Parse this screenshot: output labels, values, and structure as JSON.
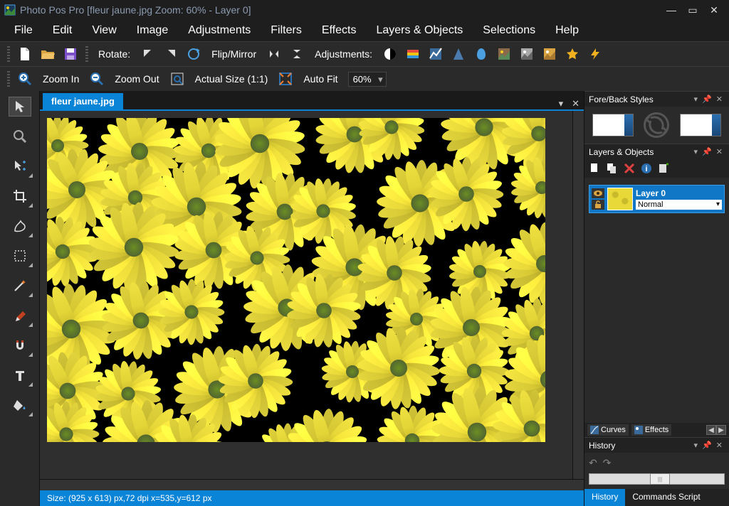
{
  "titlebar": {
    "app_name": "Photo Pos Pro",
    "document": "[fleur jaune.jpg Zoom: 60% - Layer 0]"
  },
  "menu": {
    "items": [
      "File",
      "Edit",
      "View",
      "Image",
      "Adjustments",
      "Filters",
      "Effects",
      "Layers & Objects",
      "Selections",
      "Help"
    ]
  },
  "toolbar1": {
    "rotate_label": "Rotate:",
    "flip_label": "Flip/Mirror",
    "adjustments_label": "Adjustments:"
  },
  "toolbar2": {
    "zoom_in": "Zoom In",
    "zoom_out": "Zoom Out",
    "actual_size": "Actual Size (1:1)",
    "auto_fit": "Auto Fit",
    "zoom_value": "60%"
  },
  "document_tab": {
    "name": "fleur jaune.jpg"
  },
  "status": {
    "text": "Size: (925 x 613) px,72 dpi   x=535,y=612 px"
  },
  "panels": {
    "fore_back": {
      "title": "Fore/Back Styles"
    },
    "layers": {
      "title": "Layers & Objects",
      "items": [
        {
          "name": "Layer 0",
          "blend_mode": "Normal",
          "visible": true,
          "locked": false
        }
      ],
      "bottom_tabs": {
        "curves": "Curves",
        "effects": "Effects"
      }
    },
    "history": {
      "title": "History",
      "tabs": {
        "history": "History",
        "commands": "Commands Script"
      }
    }
  },
  "colors": {
    "accent": "#0a84d6",
    "bg": "#2a2a2a",
    "bg_dark": "#1e1e1e"
  }
}
